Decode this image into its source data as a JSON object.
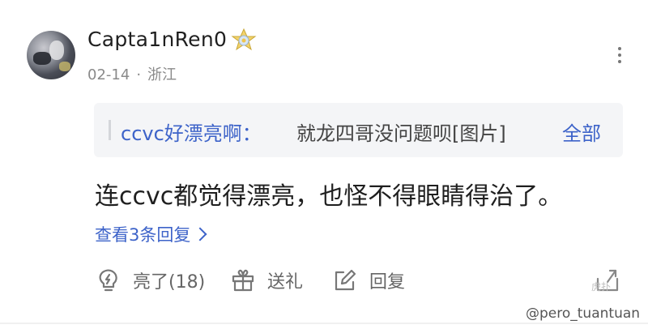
{
  "comment": {
    "username": "Capta1nRen0",
    "date": "02-14",
    "separator": "·",
    "location": "浙江",
    "quote": {
      "author": "ccvc好漂亮啊：",
      "text": "就龙四哥没问题呗[图片]",
      "expand_label": "全部"
    },
    "content": "连ccvc都觉得漂亮，也怪不得眼睛得治了。",
    "view_replies": "查看3条回复"
  },
  "actions": {
    "like_label": "亮了(18)",
    "gift_label": "送礼",
    "reply_label": "回复"
  },
  "watermark": {
    "logo": "虎扑",
    "handle": "@pero_tuantuan"
  },
  "colors": {
    "link_blue": "#3d63c9",
    "quote_bg": "#f4f5f7",
    "meta_gray": "#8a8a8a"
  },
  "icons": [
    "avatar",
    "level-badge-icon",
    "more-vertical-icon",
    "lightbulb-icon",
    "gift-icon",
    "edit-reply-icon",
    "share-icon"
  ]
}
